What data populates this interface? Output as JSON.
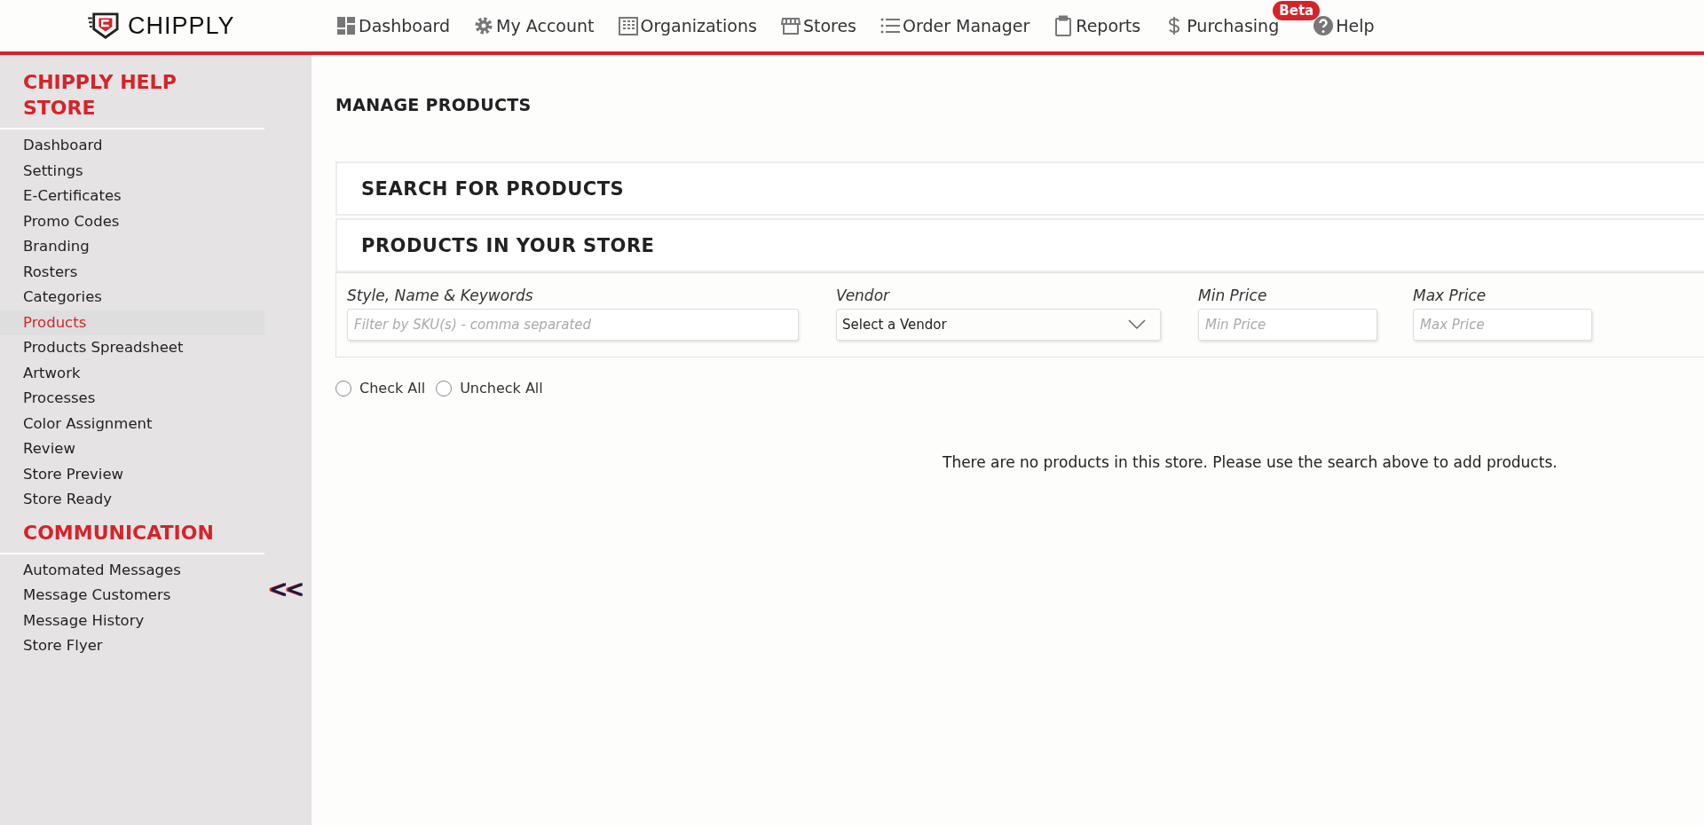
{
  "header": {
    "logo_text": "CHIPPLY",
    "nav": [
      {
        "label": "Dashboard"
      },
      {
        "label": "My Account"
      },
      {
        "label": "Organizations"
      },
      {
        "label": "Stores"
      },
      {
        "label": "Order Manager"
      },
      {
        "label": "Reports"
      },
      {
        "label": "Purchasing",
        "badge": "Beta"
      },
      {
        "label": "Help"
      }
    ]
  },
  "sidebar": {
    "sections": [
      {
        "title": "CHIPPLY HELP STORE",
        "items": [
          {
            "label": "Dashboard",
            "selected": false
          },
          {
            "label": "Settings",
            "selected": false
          },
          {
            "label": "E-Certificates",
            "selected": false
          },
          {
            "label": "Promo Codes",
            "selected": false
          },
          {
            "label": "Branding",
            "selected": false
          },
          {
            "label": "Rosters",
            "selected": false
          },
          {
            "label": "Categories",
            "selected": false
          },
          {
            "label": "Products",
            "selected": true
          },
          {
            "label": "Products Spreadsheet",
            "selected": false
          },
          {
            "label": "Artwork",
            "selected": false
          },
          {
            "label": "Processes",
            "selected": false
          },
          {
            "label": "Color Assignment",
            "selected": false
          },
          {
            "label": "Review",
            "selected": false
          },
          {
            "label": "Store Preview",
            "selected": false
          },
          {
            "label": "Store Ready",
            "selected": false
          }
        ]
      },
      {
        "title": "COMMUNICATION",
        "items": [
          {
            "label": "Automated Messages",
            "selected": false
          },
          {
            "label": "Message Customers",
            "selected": false
          },
          {
            "label": "Message History",
            "selected": false
          },
          {
            "label": "Store Flyer",
            "selected": false
          }
        ]
      }
    ],
    "collapse": "<<"
  },
  "page_title": "MANAGE PRODUCTS",
  "panels": [
    {
      "title": "SEARCH FOR PRODUCTS"
    },
    {
      "title": "PRODUCTS IN YOUR STORE"
    }
  ],
  "filters": [
    {
      "kind": "text",
      "label": "Style, Name & Keywords",
      "placeholder": "Filter by SKU(s) - comma separated"
    },
    {
      "kind": "select",
      "label": "Vendor",
      "value": "Select a Vendor"
    },
    {
      "kind": "text",
      "label": "Min Price",
      "placeholder": "Min Price"
    },
    {
      "kind": "text",
      "label": "Max Price",
      "placeholder": "Max Price"
    }
  ],
  "check_options": [
    {
      "label": "Check All",
      "selected": false
    },
    {
      "label": "Uncheck All",
      "selected": false
    }
  ],
  "empty_message": "There are no products in this store. Please use the search above to add products."
}
